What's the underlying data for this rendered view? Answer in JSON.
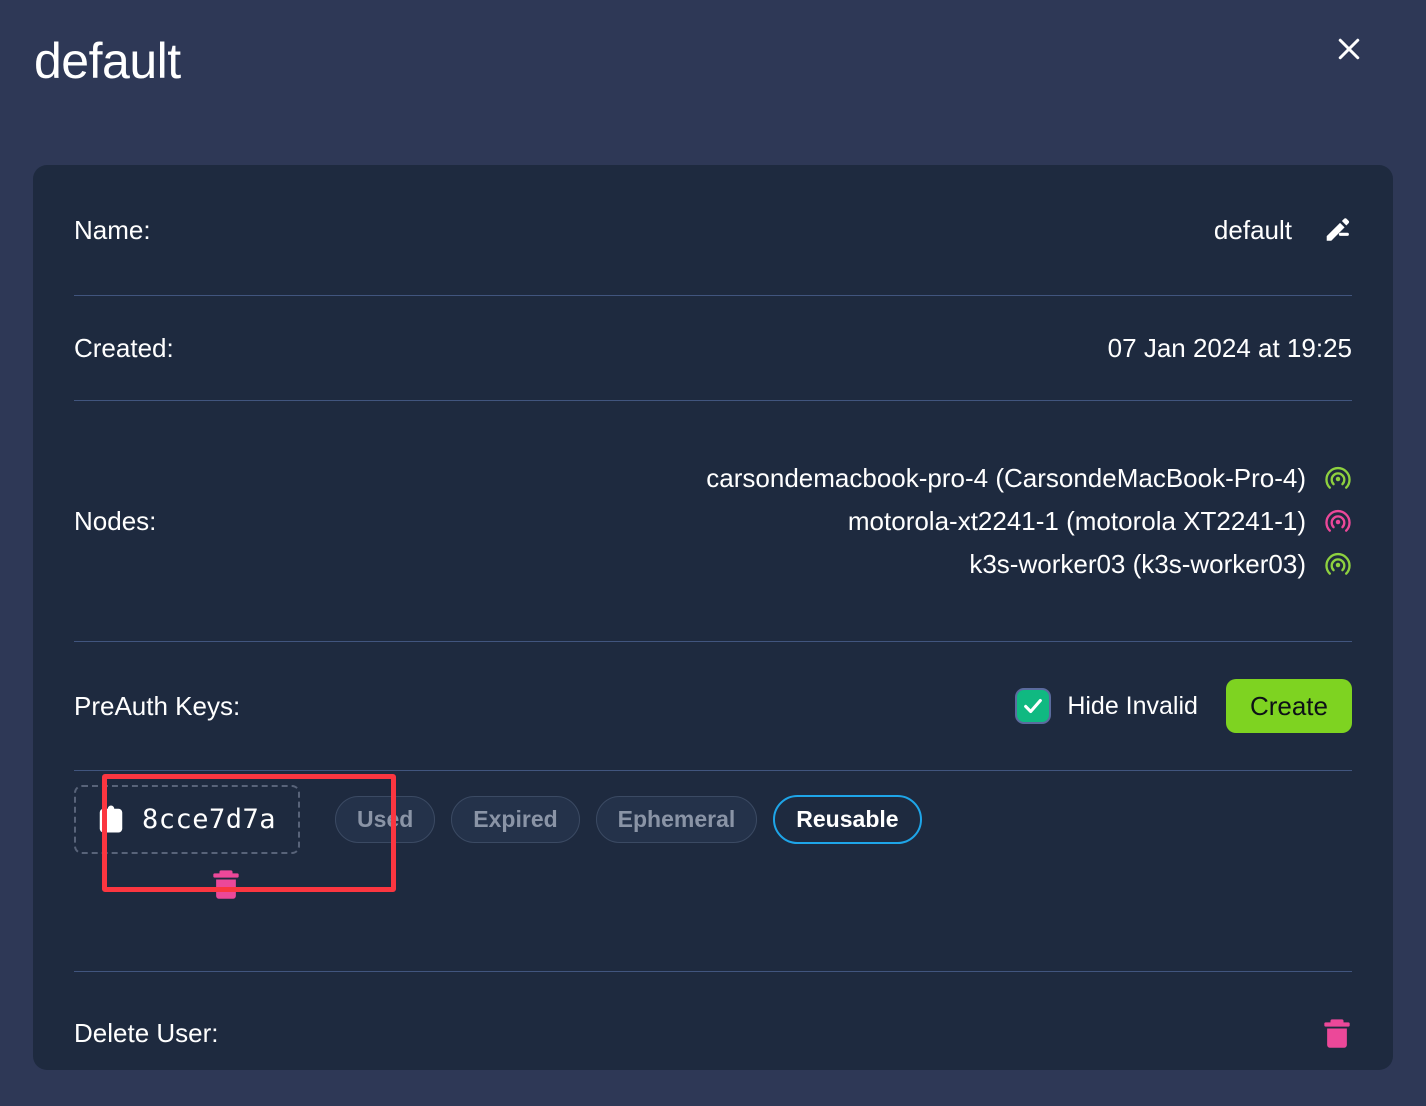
{
  "header": {
    "title": "default",
    "close_icon": "close-icon"
  },
  "details": {
    "name": {
      "label": "Name:",
      "value": "default",
      "edit_icon": "pencil-edit-icon"
    },
    "created": {
      "label": "Created:",
      "value": "07 Jan 2024 at 19:25"
    },
    "nodes": {
      "label": "Nodes:",
      "items": [
        {
          "name": "carsondemacbook-pro-4 (CarsondeMacBook-Pro-4)",
          "status_icon": "signal-online-icon",
          "status_color": "#8ed13f"
        },
        {
          "name": "motorola-xt2241-1 (motorola XT2241-1)",
          "status_icon": "signal-offline-icon",
          "status_color": "#ec4899"
        },
        {
          "name": "k3s-worker03 (k3s-worker03)",
          "status_icon": "signal-online-icon",
          "status_color": "#8ed13f"
        }
      ]
    },
    "preauth_keys": {
      "label": "PreAuth Keys:",
      "hide_invalid_label": "Hide Invalid",
      "hide_invalid_checked": true,
      "create_label": "Create",
      "keys": [
        {
          "value": "8cce7d7a",
          "copy_icon": "clipboard-copy-icon",
          "delete_icon": "trash-icon",
          "badges": [
            {
              "label": "Used",
              "active": false
            },
            {
              "label": "Expired",
              "active": false
            },
            {
              "label": "Ephemeral",
              "active": false
            },
            {
              "label": "Reusable",
              "active": true
            }
          ]
        }
      ]
    },
    "delete_user": {
      "label": "Delete User:",
      "delete_icon": "trash-icon"
    }
  },
  "colors": {
    "page_background": "#2e3856",
    "card_background": "#1e2a3f",
    "divider": "#41557e",
    "accent_create": "#7ed321",
    "accent_checkbox": "#10b981",
    "accent_danger": "#ec4899",
    "accent_badge_active": "#1ea5e8",
    "highlight_annotation": "#fb3640",
    "node_online": "#8ed13f",
    "node_offline": "#ec4899"
  }
}
